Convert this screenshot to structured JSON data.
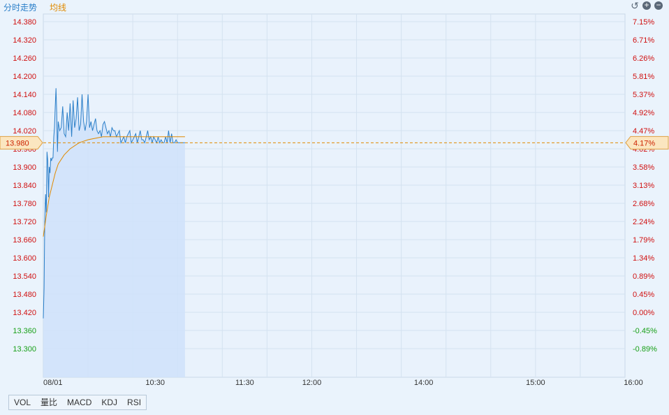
{
  "header": {
    "tab_intraday": "分时走势",
    "tab_avg": "均线",
    "controls": [
      {
        "icon": "reset-icon",
        "glyph": "↺"
      },
      {
        "icon": "zoom-in-icon",
        "glyph": "+"
      },
      {
        "icon": "zoom-out-icon",
        "glyph": "−"
      }
    ]
  },
  "chart_data": {
    "type": "line",
    "price_ticks": [
      "14.380",
      "14.320",
      "14.260",
      "14.200",
      "14.140",
      "14.080",
      "14.020",
      "13.960",
      "13.900",
      "13.840",
      "13.780",
      "13.720",
      "13.660",
      "13.600",
      "13.540",
      "13.480",
      "13.420",
      "13.360",
      "13.300"
    ],
    "pct_ticks": [
      "7.15%",
      "6.71%",
      "6.26%",
      "5.81%",
      "5.37%",
      "4.92%",
      "4.47%",
      "4.02%",
      "3.58%",
      "3.13%",
      "2.68%",
      "2.24%",
      "1.79%",
      "1.34%",
      "0.89%",
      "0.45%",
      "0.00%",
      "-0.45%",
      "-0.89%"
    ],
    "base_price": 13.42,
    "current_price": "13.980",
    "current_pct": "4.17%",
    "x_labels": [
      "08/01",
      "10:30",
      "11:30",
      "12:00",
      "14:00",
      "15:00",
      "16:00"
    ],
    "ylim": [
      13.24,
      14.41
    ],
    "x_unit": "minutes since 09:30",
    "xlim": [
      0,
      390
    ],
    "colors": {
      "price": "#2b7fc8",
      "avg": "#e08a00",
      "fill": "#cfe2fa",
      "up": "#d01010",
      "down": "#18a018"
    },
    "series": [
      {
        "name": "分时",
        "x": [
          0,
          0.5,
          1,
          1.5,
          2,
          2.5,
          3,
          3.5,
          4,
          4.5,
          5,
          5.5,
          6,
          6.5,
          7,
          7.5,
          8,
          8.5,
          9,
          9.5,
          10,
          11,
          12,
          13,
          14,
          15,
          16,
          17,
          18,
          19,
          20,
          21,
          22,
          23,
          24,
          25,
          26,
          27,
          28,
          29,
          30,
          31,
          32,
          33,
          34,
          35,
          36,
          37,
          38,
          39,
          40,
          41,
          42,
          43,
          44,
          45,
          46,
          47,
          48,
          49,
          50,
          51,
          52,
          53,
          54,
          55,
          56,
          57,
          58,
          59,
          60,
          61,
          62,
          63,
          64,
          65,
          66,
          67,
          68,
          69,
          70,
          71,
          72,
          73,
          74,
          75,
          76,
          77,
          78,
          79,
          80,
          81,
          82,
          83,
          84,
          85,
          86,
          87,
          88,
          89,
          90,
          91,
          92,
          93,
          94,
          95
        ],
        "values": [
          13.4,
          13.5,
          13.72,
          13.81,
          13.75,
          13.95,
          13.92,
          13.8,
          13.9,
          13.88,
          13.93,
          13.92,
          13.93,
          13.93,
          14,
          14.03,
          14.1,
          14.16,
          14.08,
          13.95,
          14.05,
          14.02,
          14.03,
          14.1,
          14.01,
          14.0,
          14.08,
          14.02,
          14.11,
          14.0,
          14.12,
          14.03,
          14.06,
          14.13,
          14.02,
          14.04,
          14.14,
          14.05,
          14.02,
          14.05,
          14.14,
          14.03,
          14.05,
          14.02,
          14.04,
          14.06,
          14.02,
          14.01,
          14.02,
          14.0,
          14.04,
          14.05,
          14.03,
          14.01,
          14.02,
          14.0,
          14.03,
          14.02,
          14.02,
          14.0,
          14.01,
          14.02,
          13.98,
          13.99,
          14.0,
          13.98,
          14.0,
          14.01,
          14.02,
          13.98,
          13.99,
          14.0,
          14.01,
          13.98,
          14.0,
          14.02,
          13.99,
          13.99,
          13.98,
          14.0,
          14.02,
          13.99,
          14.0,
          13.98,
          14.0,
          13.99,
          13.98,
          14.0,
          13.98,
          13.99,
          13.98,
          13.98,
          14.0,
          13.98,
          14.02,
          13.98,
          14.01,
          13.98,
          13.98,
          13.99,
          13.98,
          13.98,
          13.98,
          13.98,
          13.98,
          13.98
        ]
      },
      {
        "name": "均线",
        "x": [
          0,
          2,
          4,
          6,
          8,
          10,
          14,
          18,
          24,
          30,
          40,
          50,
          60,
          70,
          80,
          90,
          95
        ],
        "values": [
          13.67,
          13.74,
          13.8,
          13.84,
          13.88,
          13.91,
          13.94,
          13.96,
          13.98,
          13.99,
          14.0,
          14.0,
          14.0,
          14.0,
          14.0,
          14.0,
          14.0
        ]
      }
    ]
  },
  "bottom_tabs": [
    "VOL",
    "量比",
    "MACD",
    "KDJ",
    "RSI"
  ]
}
